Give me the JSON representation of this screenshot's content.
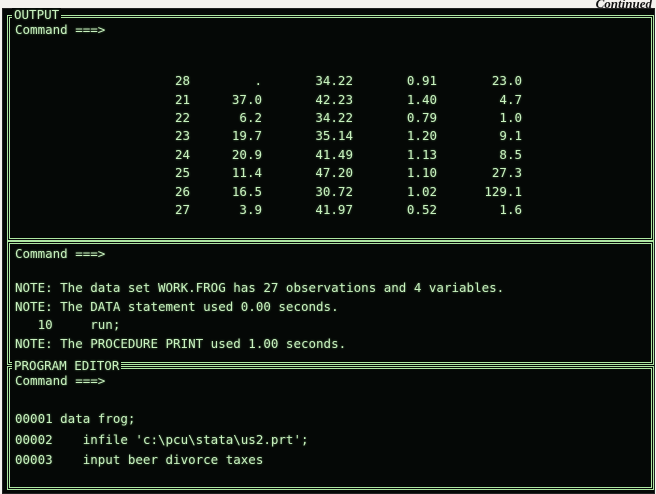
{
  "continued_label": "Continued",
  "output_window": {
    "title": "OUTPUT",
    "command_prompt": "Command ===>",
    "rows": [
      [
        "28",
        ".",
        "34.22",
        "0.91",
        "23.0"
      ],
      [
        "21",
        "37.0",
        "42.23",
        "1.40",
        "4.7"
      ],
      [
        "22",
        "6.2",
        "34.22",
        "0.79",
        "1.0"
      ],
      [
        "23",
        "19.7",
        "35.14",
        "1.20",
        "9.1"
      ],
      [
        "24",
        "20.9",
        "41.49",
        "1.13",
        "8.5"
      ],
      [
        "25",
        "11.4",
        "47.20",
        "1.10",
        "27.3"
      ],
      [
        "26",
        "16.5",
        "30.72",
        "1.02",
        "129.1"
      ],
      [
        "27",
        "3.9",
        "41.97",
        "0.52",
        "1.6"
      ]
    ]
  },
  "log_window": {
    "command_prompt": "Command ===>",
    "lines": [
      "NOTE: The data set WORK.FROG has 27 observations and 4 variables.",
      "NOTE: The DATA statement used 0.00 seconds.",
      "   10     run;",
      "NOTE: The PROCEDURE PRINT used 1.00 seconds."
    ]
  },
  "editor_window": {
    "title": "PROGRAM EDITOR",
    "command_prompt": "Command ===>",
    "lines": [
      "00001 data frog;",
      "00002    infile 'c:\\pcu\\stata\\us2.prt';",
      "00003    input beer divorce taxes"
    ]
  }
}
